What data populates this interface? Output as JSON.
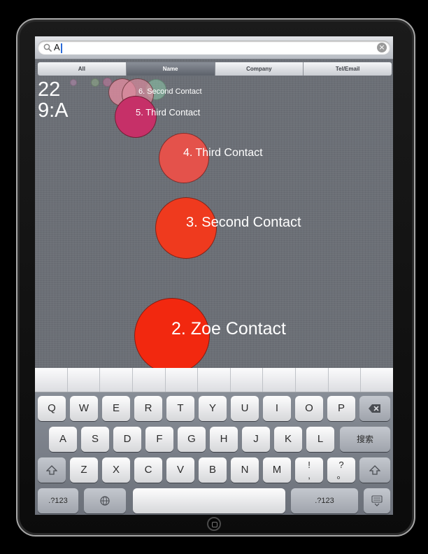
{
  "search": {
    "value": "A",
    "clear_icon": "clear-icon",
    "search_icon": "search-icon"
  },
  "filter_tabs": [
    {
      "label": "All",
      "active": false
    },
    {
      "label": "Name",
      "active": true
    },
    {
      "label": "Company",
      "active": false
    },
    {
      "label": "Tel/Email",
      "active": false
    }
  ],
  "corner_labels": [
    "22",
    "9:A"
  ],
  "contacts": [
    {
      "label": "6. Second Contact",
      "color": "#d88a9c"
    },
    {
      "label": "5. Third Contact",
      "color": "#c63068"
    },
    {
      "label": "4. Third Contact",
      "color": "#e4524b"
    },
    {
      "label": "3. Second Contact",
      "color": "#ef3a1e"
    },
    {
      "label": "2. Zoe Contact",
      "color": "#f2280f"
    }
  ],
  "keyboard": {
    "row1": [
      "Q",
      "W",
      "E",
      "R",
      "T",
      "Y",
      "U",
      "I",
      "O",
      "P"
    ],
    "row2": [
      "A",
      "S",
      "D",
      "F",
      "G",
      "H",
      "J",
      "K",
      "L"
    ],
    "row3": [
      "Z",
      "X",
      "C",
      "V",
      "B",
      "N",
      "M"
    ],
    "search_key": "搜索",
    "punct1": "!\n,",
    "punct2": "?\n。",
    "numbers_label": ".?123",
    "icons": {
      "backspace": "backspace-icon",
      "shift": "shift-icon",
      "globe": "globe-icon",
      "hide_keyboard": "hide-keyboard-icon"
    }
  }
}
